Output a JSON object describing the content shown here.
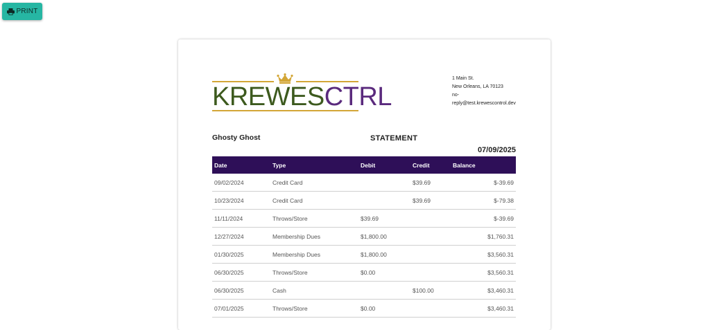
{
  "toolbar": {
    "print_label": "PRINT",
    "print_icon": "printer-icon"
  },
  "brand": {
    "logo_part1": "KREWES",
    "logo_part2": "CTRL",
    "logo_icon": "crown-icon",
    "colors": {
      "green": "#3d5a1e",
      "purple": "#5a2a7d",
      "gold": "#d3a636",
      "header_bg": "#2e0f58",
      "print_button": "#26b6a3"
    }
  },
  "address": {
    "line1": "1 Main St.",
    "line2": "New Orleans, LA 70123",
    "line3": "no-",
    "line4": "reply@test.krewescontrol.dev"
  },
  "statement": {
    "member_name": "Ghosty Ghost",
    "title": "STATEMENT",
    "date": "07/09/2025"
  },
  "table": {
    "headers": {
      "date": "Date",
      "type": "Type",
      "debit": "Debit",
      "credit": "Credit",
      "balance": "Balance"
    },
    "rows": [
      {
        "date": "09/02/2024",
        "type": "Credit Card",
        "debit": "",
        "credit": "$39.69",
        "balance": "$-39.69"
      },
      {
        "date": "10/23/2024",
        "type": "Credit Card",
        "debit": "",
        "credit": "$39.69",
        "balance": "$-79.38"
      },
      {
        "date": "11/11/2024",
        "type": "Throws/Store",
        "debit": "$39.69",
        "credit": "",
        "balance": "$-39.69"
      },
      {
        "date": "12/27/2024",
        "type": "Membership Dues",
        "debit": "$1,800.00",
        "credit": "",
        "balance": "$1,760.31"
      },
      {
        "date": "01/30/2025",
        "type": "Membership Dues",
        "debit": "$1,800.00",
        "credit": "",
        "balance": "$3,560.31"
      },
      {
        "date": "06/30/2025",
        "type": "Throws/Store",
        "debit": "$0.00",
        "credit": "",
        "balance": "$3,560.31"
      },
      {
        "date": "06/30/2025",
        "type": "Cash",
        "debit": "",
        "credit": "$100.00",
        "balance": "$3,460.31"
      },
      {
        "date": "07/01/2025",
        "type": "Throws/Store",
        "debit": "$0.00",
        "credit": "",
        "balance": "$3,460.31"
      }
    ]
  }
}
